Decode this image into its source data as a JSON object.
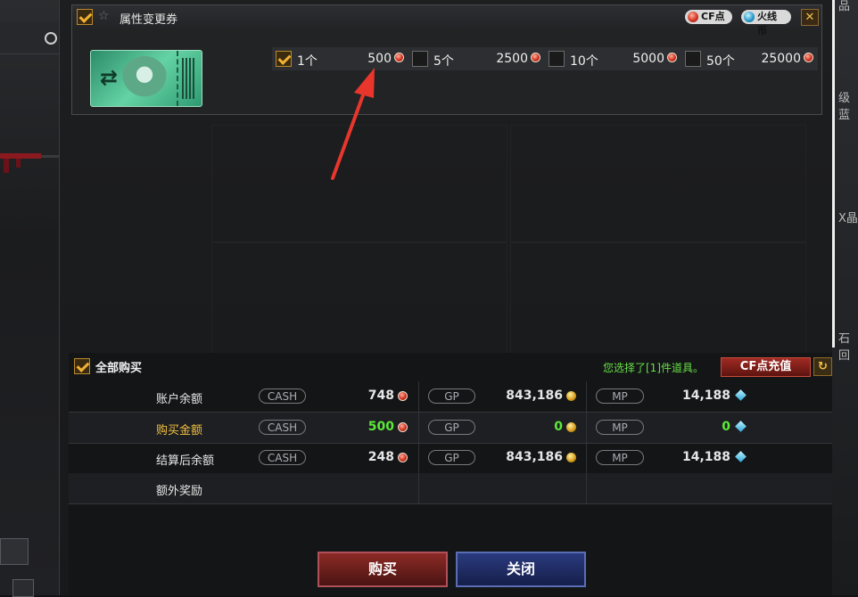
{
  "background": {
    "right_text": [
      "品",
      "级蓝",
      "X晶",
      "石回"
    ]
  },
  "item": {
    "title": "属性变更券",
    "cf_pill": "CF点",
    "huoxian_pill": "火线币",
    "close_symbol": "✕",
    "options": [
      {
        "label": "1个",
        "price": "500",
        "checked": true
      },
      {
        "label": "5个",
        "price": "2500",
        "checked": false
      },
      {
        "label": "10个",
        "price": "5000",
        "checked": false
      },
      {
        "label": "50个",
        "price": "25000",
        "checked": false
      }
    ]
  },
  "summary": {
    "buy_all_label": "全部购买",
    "selection_info": "您选择了[1]件道具。",
    "recharge_label": "CF点充值",
    "currency_tags": {
      "cash": "CASH",
      "gp": "GP",
      "mp": "MP"
    },
    "rows": [
      {
        "label": "账户余额",
        "cash": "748",
        "gp": "843,186",
        "mp": "14,188",
        "highlight": false
      },
      {
        "label": "购买金额",
        "cash": "500",
        "gp": "0",
        "mp": "0",
        "highlight": true
      },
      {
        "label": "结算后余额",
        "cash": "248",
        "gp": "843,186",
        "mp": "14,188",
        "highlight": false
      },
      {
        "label": "额外奖励"
      }
    ]
  },
  "buttons": {
    "buy": "购买",
    "close": "关闭"
  },
  "colors": {
    "accent_green": "#5bea38",
    "gold_label": "#f0c040",
    "arrow": "#e8362c"
  }
}
